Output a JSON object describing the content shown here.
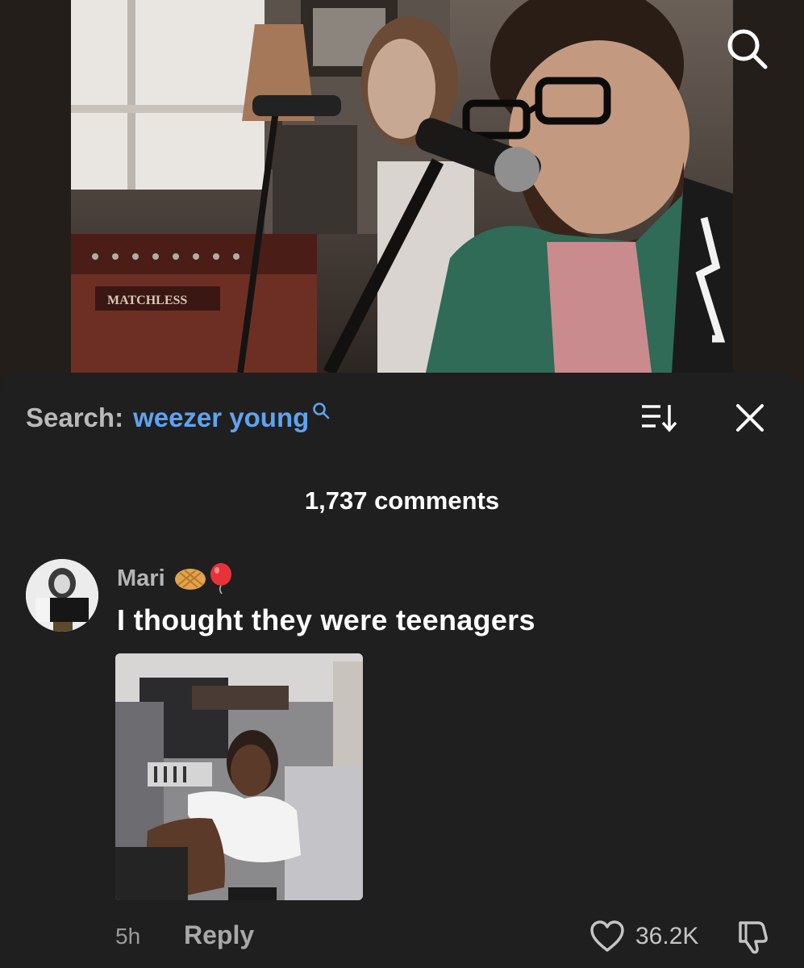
{
  "video": {
    "amp_text": "MATCHLESS"
  },
  "search": {
    "label": "Search:",
    "query": "weezer young"
  },
  "comments_count": "1,737 comments",
  "comment": {
    "username": "Mari",
    "badges": [
      "waffle-emoji",
      "balloon-emoji"
    ],
    "text": "I thought they were teenagers",
    "time": "5h",
    "reply_label": "Reply",
    "likes": "36.2K"
  },
  "colors": {
    "sheet_bg": "#1f1f1f",
    "query_blue": "#5fa3f0",
    "muted_text": "#b5b5b5"
  }
}
